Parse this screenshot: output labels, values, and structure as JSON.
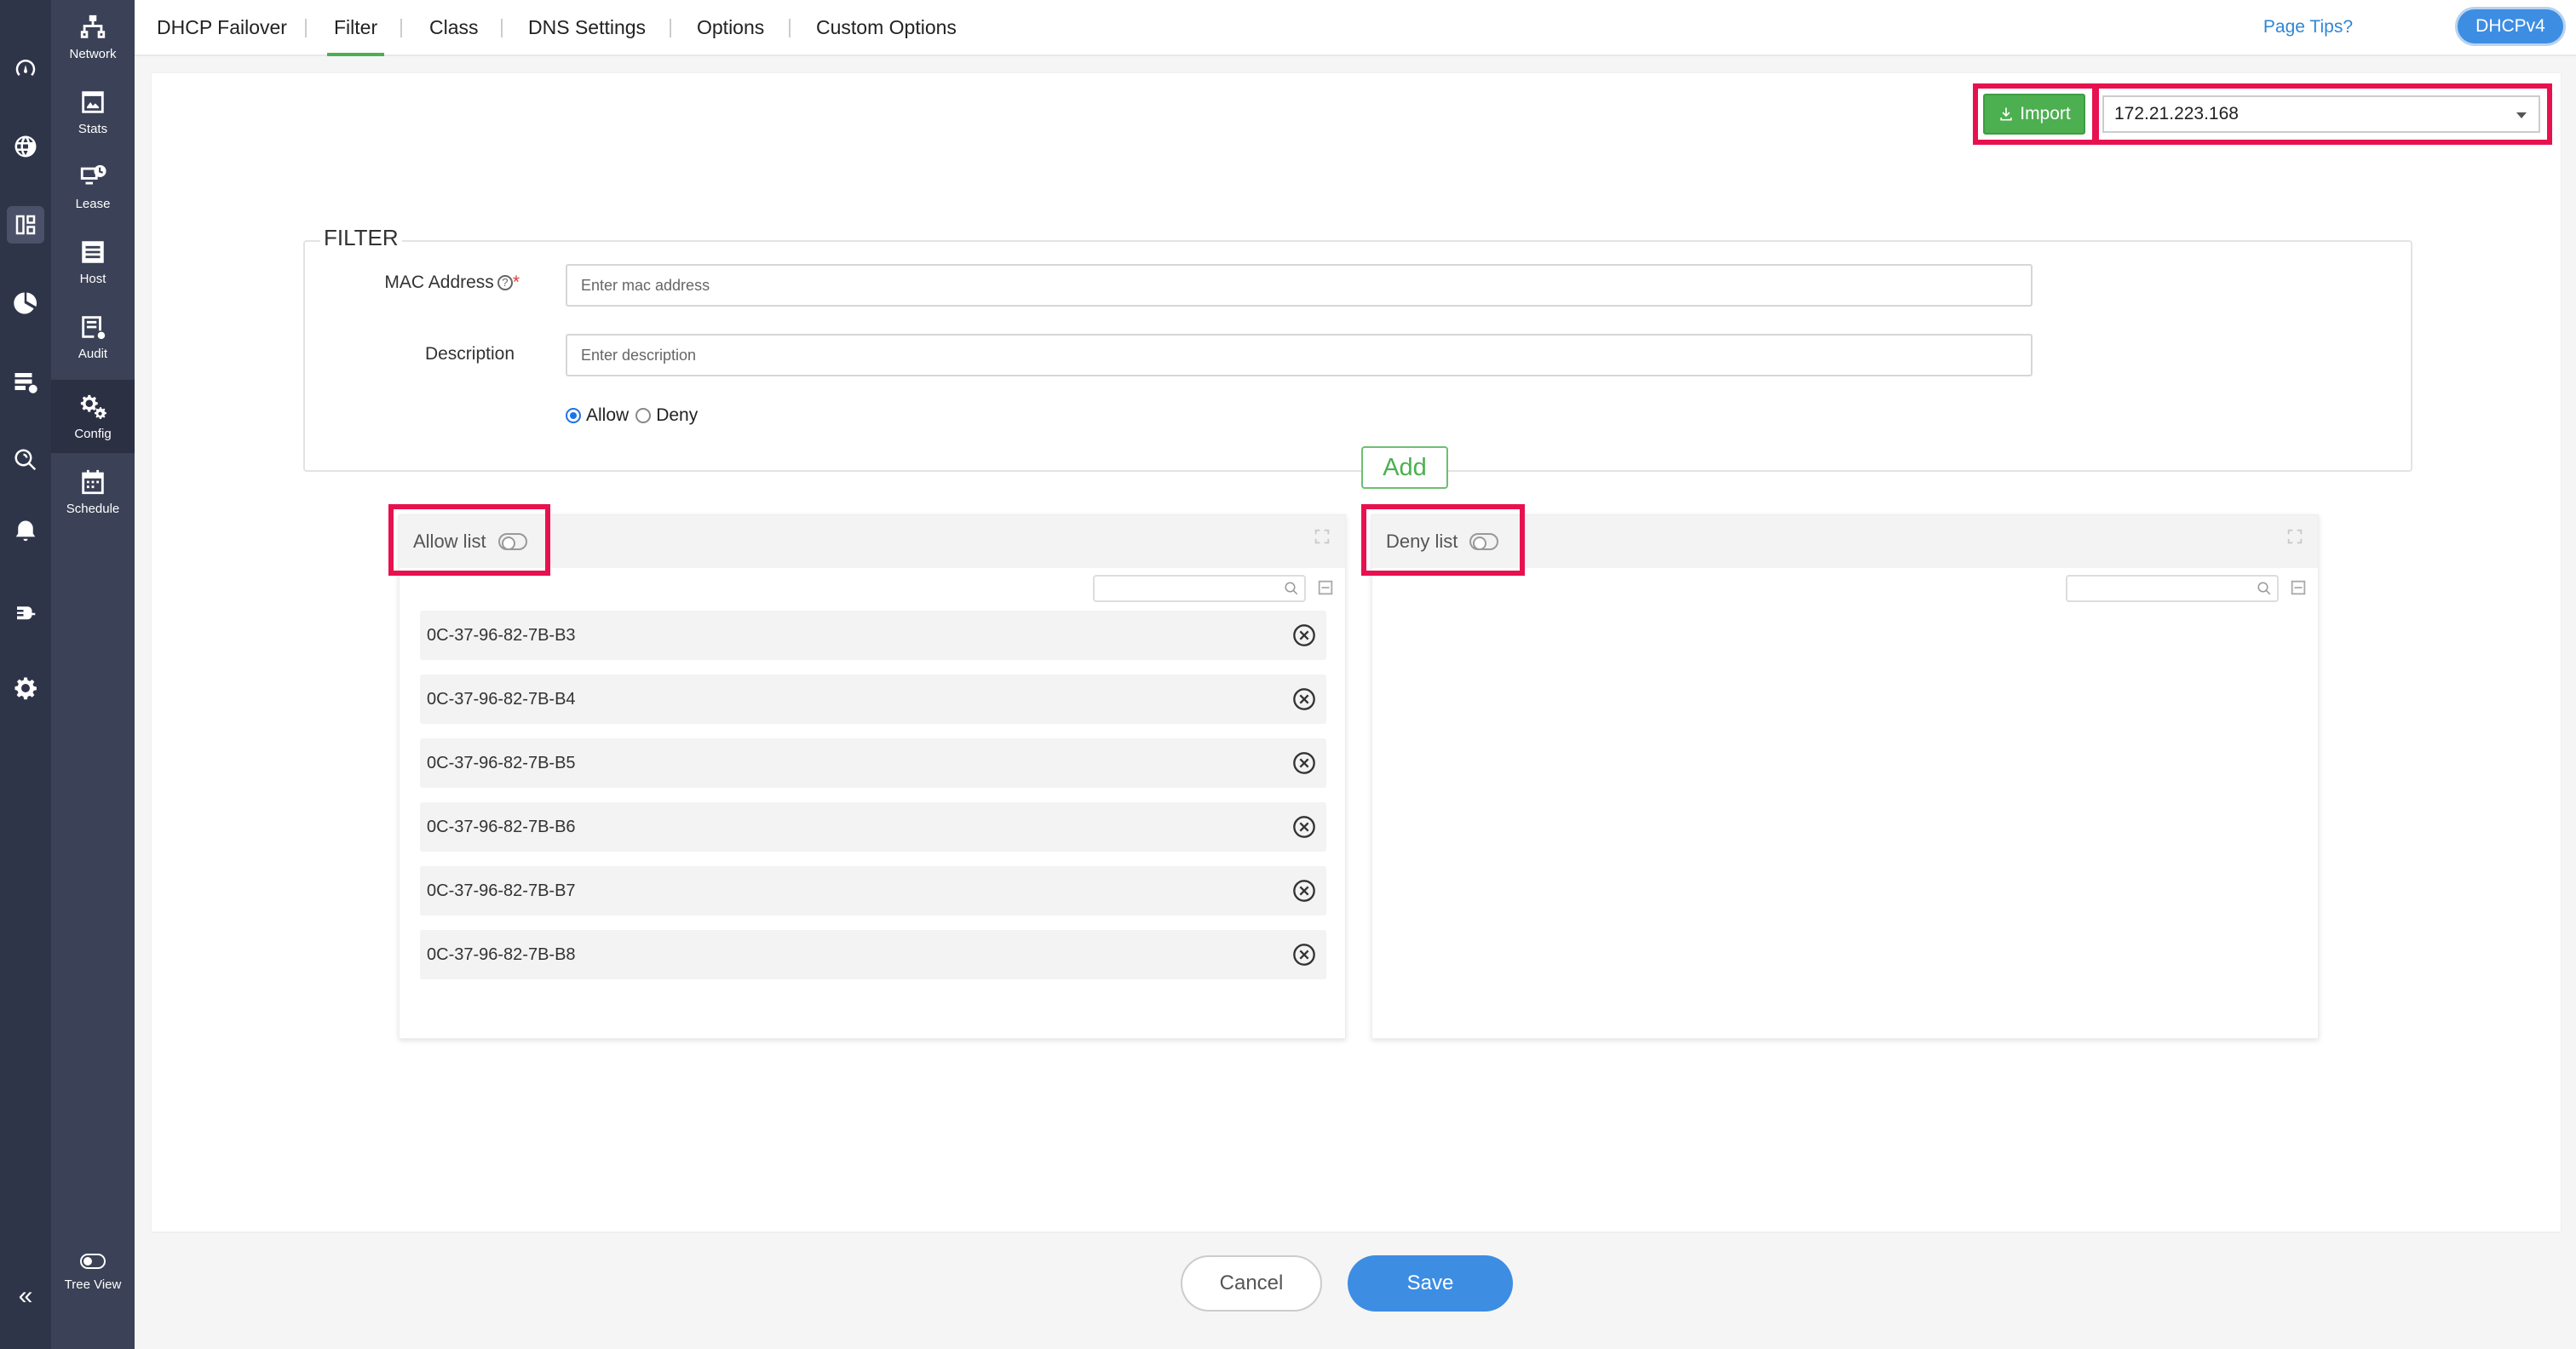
{
  "rail": {
    "collapse_glyph": "«"
  },
  "sidebar": {
    "items": [
      {
        "label": "Network",
        "icon": "network-icon"
      },
      {
        "label": "Stats",
        "icon": "stats-icon"
      },
      {
        "label": "Lease",
        "icon": "lease-icon"
      },
      {
        "label": "Host",
        "icon": "host-icon"
      },
      {
        "label": "Audit",
        "icon": "audit-icon"
      },
      {
        "label": "Config",
        "icon": "config-icon",
        "active": true
      },
      {
        "label": "Schedule",
        "icon": "schedule-icon"
      }
    ],
    "tree_view_label": "Tree View"
  },
  "topnav": {
    "tabs": [
      {
        "label": "DHCP Failover"
      },
      {
        "label": "Filter",
        "active": true
      },
      {
        "label": "Class"
      },
      {
        "label": "DNS Settings"
      },
      {
        "label": "Options"
      },
      {
        "label": "Custom Options"
      }
    ],
    "page_tips": "Page Tips?",
    "protocol": "DHCPv4"
  },
  "toolbar": {
    "import_label": "Import",
    "server_ip": "172.21.223.168"
  },
  "filter": {
    "legend": "FILTER",
    "mac_label": "MAC Address",
    "mac_help": "?",
    "mac_required": "*",
    "mac_placeholder": "Enter mac address",
    "description_label": "Description",
    "description_placeholder": "Enter description",
    "allow_label": "Allow",
    "deny_label": "Deny",
    "add_label": "Add"
  },
  "allow_list": {
    "title": "Allow list",
    "items": [
      "0C-37-96-82-7B-B3",
      "0C-37-96-82-7B-B4",
      "0C-37-96-82-7B-B5",
      "0C-37-96-82-7B-B6",
      "0C-37-96-82-7B-B7",
      "0C-37-96-82-7B-B8"
    ]
  },
  "deny_list": {
    "title": "Deny list",
    "items": []
  },
  "footer": {
    "cancel_label": "Cancel",
    "save_label": "Save"
  },
  "colors": {
    "highlight": "#e8114f",
    "accent_green": "#4caf50",
    "accent_blue": "#3d8de3",
    "rail_bg": "#2f3549",
    "sidebar_bg": "#3b4156"
  }
}
